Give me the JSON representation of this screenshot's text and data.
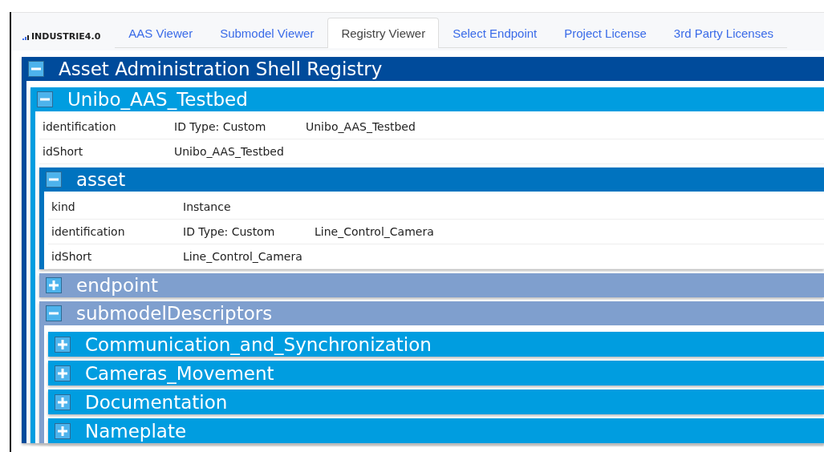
{
  "header": {
    "logo": "INDUSTRIE4.0",
    "tabs": [
      {
        "label": "AAS Viewer",
        "selected": false
      },
      {
        "label": "Submodel Viewer",
        "selected": false
      },
      {
        "label": "Registry Viewer",
        "selected": true
      },
      {
        "label": "Select Endpoint",
        "selected": false
      },
      {
        "label": "Project License",
        "selected": false
      },
      {
        "label": "3rd Party Licenses",
        "selected": false
      }
    ]
  },
  "tree": {
    "title": "Asset Administration Shell Registry",
    "kind": "registry",
    "expanded": true,
    "children": [
      {
        "title": "Unibo_AAS_Testbed",
        "kind": "shell",
        "expanded": true,
        "rows": [
          {
            "cells": [
              "identification",
              "ID Type: Custom",
              "Unibo_AAS_Testbed"
            ]
          },
          {
            "cells": [
              "idShort",
              "Unibo_AAS_Testbed"
            ]
          }
        ],
        "children": [
          {
            "title": "asset",
            "kind": "asset",
            "expanded": true,
            "rows": [
              {
                "cells": [
                  "kind",
                  "Instance"
                ]
              },
              {
                "cells": [
                  "identification",
                  "ID Type: Custom",
                  "Line_Control_Camera"
                ]
              },
              {
                "cells": [
                  "idShort",
                  "Line_Control_Camera"
                ]
              }
            ]
          },
          {
            "title": "endpoint",
            "kind": "group",
            "expanded": false
          },
          {
            "title": "submodelDescriptors",
            "kind": "group",
            "expanded": true,
            "children": [
              {
                "title": "Communication_and_Synchronization",
                "kind": "submodel",
                "expanded": false
              },
              {
                "title": "Cameras_Movement",
                "kind": "submodel",
                "expanded": false
              },
              {
                "title": "Documentation",
                "kind": "submodel",
                "expanded": false
              },
              {
                "title": "Nameplate",
                "kind": "submodel",
                "expanded": false
              }
            ]
          }
        ]
      }
    ]
  }
}
